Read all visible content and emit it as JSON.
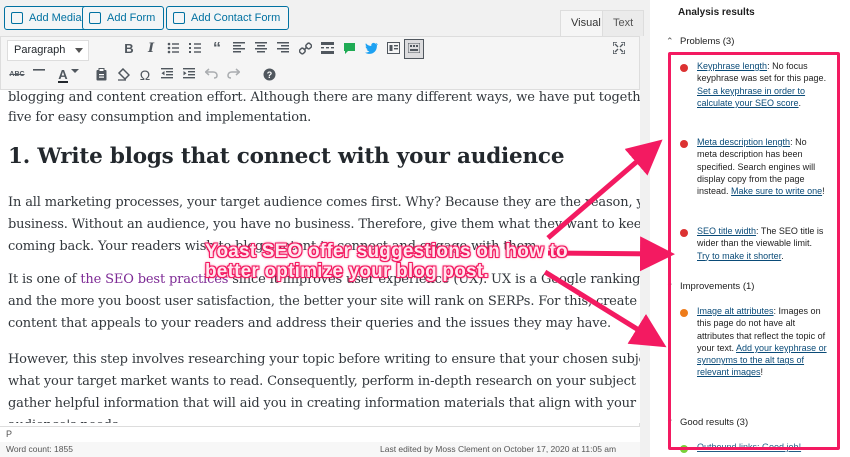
{
  "media_buttons": {
    "add_media": "Add Media",
    "add_form": "Add Form",
    "add_contact_form": "Add Contact Form"
  },
  "editor_tabs": {
    "visual": "Visual",
    "text": "Text"
  },
  "toolbar": {
    "format_select": "Paragraph",
    "icons": [
      "bold-icon",
      "italic-icon",
      "bullet-list-icon",
      "numbered-list-icon",
      "blockquote-icon",
      "align-left-icon",
      "align-center-icon",
      "align-right-icon",
      "link-icon",
      "read-more-icon",
      "chat-icon",
      "twitter-icon",
      "grid-icon",
      "toolbar-toggle-icon",
      "fullscreen-icon",
      "strikethrough-icon",
      "horizontal-line-icon",
      "text-color-icon",
      "paste-text-icon",
      "clear-formatting-icon",
      "special-character-icon",
      "outdent-icon",
      "indent-icon",
      "undo-icon",
      "redo-icon",
      "help-icon"
    ]
  },
  "content": {
    "line1": "blogging and content creation effort. Although there are many different ways, we have put together the top",
    "line2": "five for easy consumption and implementation.",
    "heading": "1. Write blogs that connect with your audience",
    "p1_l1": "In all marketing processes, your target audience comes first. Why? Because they are the reason, you are in",
    "p1_l2": "business. Without an audience, you have no business. Therefore, give them what they want to keep them",
    "p1_l3": "coming back. Your readers wish to blog content to connect and engage with them.",
    "p2_l1_pre": "It is one of ",
    "p2_l1_link": "the SEO best practices",
    "p2_l1_post": " since it improves user experience (UX). UX is a Google ranking factor,",
    "p2_l2": "and the more you boost user satisfaction, the better your site will rank on SERPs. For this, create blog",
    "p2_l3": "content that appeals to your readers and address their queries and the issues they may have.",
    "p3_l1": "However, this step involves researching your topic before writing to ensure that your chosen subject is",
    "p3_l2": "what your target market wants to read. Consequently, perform in-depth research on your subject and",
    "p3_l3": "gather helpful information that will aid you in creating information materials that align with your",
    "p3_l4": "audience's needs."
  },
  "path_bar": "P",
  "status": {
    "word_count": "Word count: 1855",
    "last_edited": "Last edited by Moss Clement on October 17, 2020 at 11:05 am"
  },
  "annotation": {
    "line1": "Yoast SEO offer suggestions on how to",
    "line2": "better optimize your blog post."
  },
  "analysis": {
    "title": "Analysis results",
    "problems_heading": "Problems (3)",
    "improvements_heading": "Improvements (1)",
    "good_heading": "Good results (3)",
    "good_first_partial": "Outbound links: Good job!",
    "problems": [
      {
        "link": "Keyphrase length",
        "text": ": No focus keyphrase was set for this page.",
        "action": "Set a keyphrase in order to calculate your SEO score",
        "end": "."
      },
      {
        "link": "Meta description length",
        "text": ": No meta description has been specified. Search engines will display copy from the page instead.",
        "action": "Make sure to write one",
        "end": "!"
      },
      {
        "link": "SEO title width",
        "text": ": The SEO title is wider than the viewable limit.",
        "action": "Try to make it shorter",
        "end": "."
      }
    ],
    "improvements": [
      {
        "link": "Image alt attributes",
        "text": ": Images on this page do not have alt attributes that reflect the topic of your text.",
        "action": "Add your keyphrase or synonyms to the alt tags of relevant images",
        "end": "!"
      }
    ]
  },
  "colors": {
    "accent": "#f31a61",
    "problem": "#dc3232",
    "improvement": "#ee7c1b",
    "good": "#7ad03a",
    "link": "#0a4b78",
    "wp_blue": "#0071a1"
  }
}
